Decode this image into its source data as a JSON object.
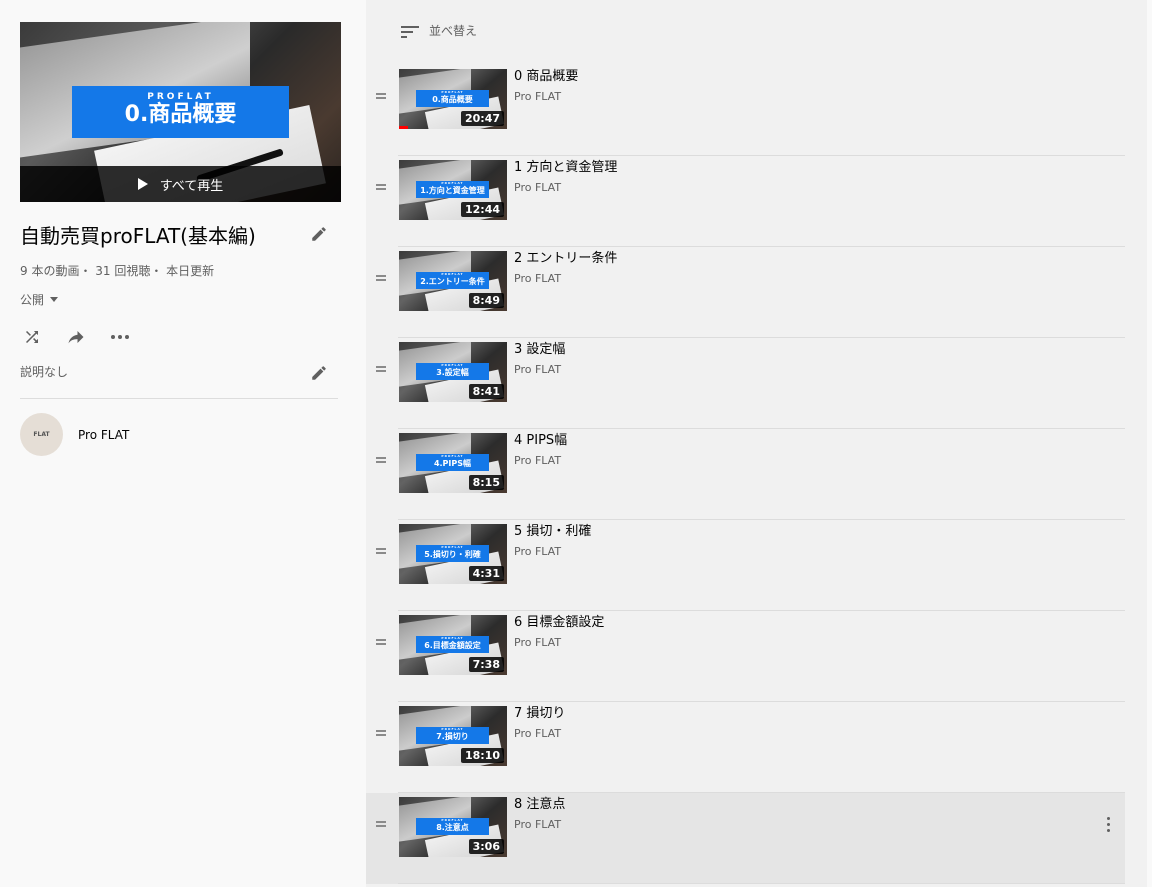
{
  "playlist": {
    "hero": {
      "brand": "PROFLAT",
      "title_text": "0.商品概要",
      "play_all_label": "すべて再生"
    },
    "title": "自動売買proFLAT(基本編)",
    "stats": "9 本の動画・ 31 回視聴・ 本日更新",
    "privacy": "公開",
    "description": "説明なし",
    "owner": {
      "name": "Pro FLAT",
      "avatar_text": "FLAT"
    },
    "icons": [
      "shuffle-icon",
      "share-icon",
      "more-horiz-icon",
      "edit-icon"
    ]
  },
  "sort": {
    "label": "並べ替え"
  },
  "videos": [
    {
      "title": "0 商品概要",
      "channel": "Pro FLAT",
      "duration": "20:47",
      "thumb_text": "0.商品概要",
      "watched_fraction": 0.08
    },
    {
      "title": "1 方向と資金管理",
      "channel": "Pro FLAT",
      "duration": "12:44",
      "thumb_text": "1.方向と資金管理"
    },
    {
      "title": "2 エントリー条件",
      "channel": "Pro FLAT",
      "duration": "8:49",
      "thumb_text": "2.エントリー条件"
    },
    {
      "title": "3 設定幅",
      "channel": "Pro FLAT",
      "duration": "8:41",
      "thumb_text": "3.設定幅"
    },
    {
      "title": "4 PIPS幅",
      "channel": "Pro FLAT",
      "duration": "8:15",
      "thumb_text": "4.PIPS幅"
    },
    {
      "title": "5 損切・利確",
      "channel": "Pro FLAT",
      "duration": "4:31",
      "thumb_text": "5.損切り・利確"
    },
    {
      "title": "6 目標金額設定",
      "channel": "Pro FLAT",
      "duration": "7:38",
      "thumb_text": "6.目標金額設定"
    },
    {
      "title": "7 損切り",
      "channel": "Pro FLAT",
      "duration": "18:10",
      "thumb_text": "7.損切り"
    },
    {
      "title": "8 注意点",
      "channel": "Pro FLAT",
      "duration": "3:06",
      "thumb_text": "8.注意点"
    }
  ]
}
